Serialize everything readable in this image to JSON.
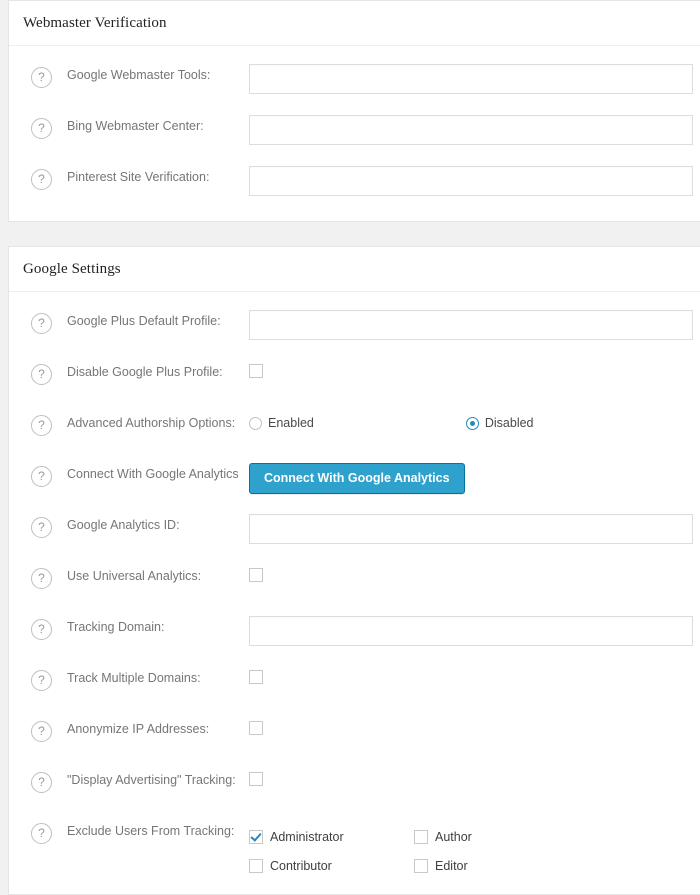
{
  "theme": {
    "accent": "#2ea2cc",
    "accent_border": "#0074a2",
    "check_color": "#1e8cbe",
    "page_bg": "#f1f1f1",
    "panel_bg": "#ffffff",
    "label_color": "#767676"
  },
  "help_icon_glyph": "?",
  "sections": [
    {
      "title": "Webmaster Verification",
      "rows": [
        {
          "help": "help-icon",
          "label": "Google Webmaster Tools:",
          "type": "text",
          "value": "",
          "placeholder": "",
          "name": "google-webmaster-tools"
        },
        {
          "help": "help-icon",
          "label": "Bing Webmaster Center:",
          "type": "text",
          "value": "",
          "placeholder": "",
          "name": "bing-webmaster-center"
        },
        {
          "help": "help-icon",
          "label": "Pinterest Site Verification:",
          "type": "text",
          "value": "",
          "placeholder": "",
          "name": "pinterest-site-verification"
        }
      ]
    },
    {
      "title": "Google Settings",
      "rows": [
        {
          "help": "help-icon",
          "label": "Google Plus Default Profile:",
          "type": "text",
          "value": "",
          "placeholder": "",
          "name": "google-plus-default-profile"
        },
        {
          "help": "help-icon",
          "label": "Disable Google Plus Profile:",
          "type": "checkbox",
          "checked": false,
          "name": "disable-google-plus-profile"
        },
        {
          "help": "help-icon",
          "label": "Advanced Authorship Options:",
          "type": "radio",
          "options": [
            "Enabled",
            "Disabled"
          ],
          "selected": "Disabled",
          "name": "advanced-authorship-options"
        },
        {
          "help": "help-icon",
          "label": "Connect With Google Analytics",
          "type": "button",
          "button_label": "Connect With Google Analytics",
          "name": "connect-with-google-analytics"
        },
        {
          "help": "help-icon",
          "label": "Google Analytics ID:",
          "type": "text",
          "value": "",
          "placeholder": "",
          "name": "google-analytics-id"
        },
        {
          "help": "help-icon",
          "label": "Use Universal Analytics:",
          "type": "checkbox",
          "checked": false,
          "name": "use-universal-analytics"
        },
        {
          "help": "help-icon",
          "label": "Tracking Domain:",
          "type": "text",
          "value": "",
          "placeholder": "",
          "name": "tracking-domain"
        },
        {
          "help": "help-icon",
          "label": "Track Multiple Domains:",
          "type": "checkbox",
          "checked": false,
          "name": "track-multiple-domains"
        },
        {
          "help": "help-icon",
          "label": "Anonymize IP Addresses:",
          "type": "checkbox",
          "checked": false,
          "name": "anonymize-ip-addresses"
        },
        {
          "help": "help-icon",
          "label": "\"Display Advertising\" Tracking:",
          "type": "checkbox",
          "checked": false,
          "name": "display-advertising-tracking"
        },
        {
          "help": "help-icon",
          "label": "Exclude Users From Tracking:",
          "type": "roles",
          "roles": [
            {
              "label": "Administrator",
              "checked": true
            },
            {
              "label": "Author",
              "checked": false
            },
            {
              "label": "Contributor",
              "checked": false
            },
            {
              "label": "Editor",
              "checked": false
            }
          ],
          "name": "exclude-users-from-tracking"
        }
      ]
    }
  ]
}
